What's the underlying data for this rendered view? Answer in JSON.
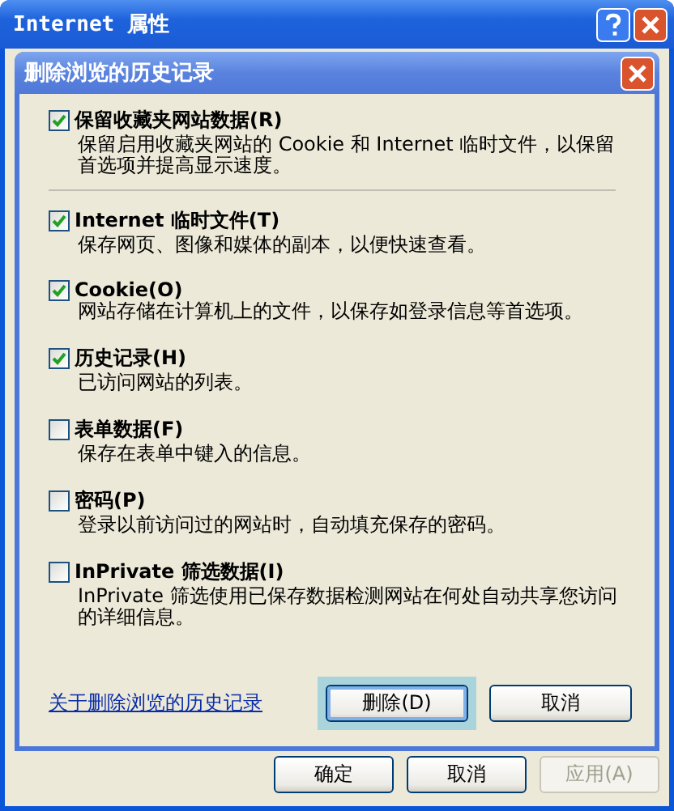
{
  "outer_window": {
    "title": "Internet 属性",
    "buttons": [
      {
        "label": "确定",
        "disabled": false
      },
      {
        "label": "取消",
        "disabled": false
      },
      {
        "label": "应用(A)",
        "disabled": true
      }
    ]
  },
  "dialog": {
    "title": "删除浏览的历史记录",
    "options": [
      {
        "label": "保留收藏夹网站数据(R)",
        "description": "保留启用收藏夹网站的 Cookie 和 Internet 临时文件，以保留首选项并提高显示速度。",
        "checked": true
      },
      {
        "label": "Internet 临时文件(T)",
        "description": "保存网页、图像和媒体的副本，以便快速查看。",
        "checked": true
      },
      {
        "label": "Cookie(O)",
        "description": "网站存储在计算机上的文件，以保存如登录信息等首选项。",
        "checked": true
      },
      {
        "label": "历史记录(H)",
        "description": "已访问网站的列表。",
        "checked": true
      },
      {
        "label": "表单数据(F)",
        "description": "保存在表单中键入的信息。",
        "checked": false
      },
      {
        "label": "密码(P)",
        "description": "登录以前访问过的网站时，自动填充保存的密码。",
        "checked": false
      },
      {
        "label": "InPrivate 筛选数据(I)",
        "description": "InPrivate 筛选使用已保存数据检测网站在何处自动共享您访问的详细信息。",
        "checked": false
      }
    ],
    "link": "关于删除浏览的历史记录",
    "buttons": [
      {
        "label": "删除(D)",
        "focused": true
      },
      {
        "label": "取消",
        "focused": false
      }
    ]
  }
}
